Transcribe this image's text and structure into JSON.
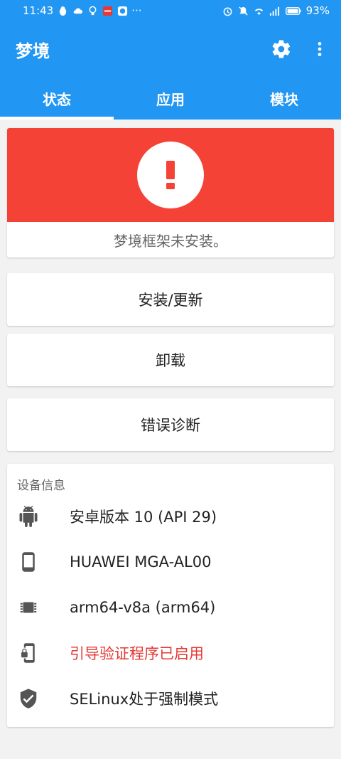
{
  "statusbar": {
    "time": "11:43",
    "more": "···",
    "battery": "93%"
  },
  "appbar": {
    "title": "梦境"
  },
  "tabs": [
    {
      "label": "状态"
    },
    {
      "label": "应用"
    },
    {
      "label": "模块"
    }
  ],
  "status": {
    "message": "梦境框架未安装。",
    "color": "#f44336"
  },
  "actions": [
    {
      "label": "安装/更新"
    },
    {
      "label": "卸载"
    },
    {
      "label": "错误诊断"
    }
  ],
  "device_info": {
    "title": "设备信息",
    "rows": [
      {
        "icon": "android-icon",
        "text": "安卓版本 10 (API 29)"
      },
      {
        "icon": "phone-icon",
        "text": "HUAWEI MGA-AL00"
      },
      {
        "icon": "chip-icon",
        "text": "arm64-v8a (arm64)"
      },
      {
        "icon": "phone-lock-icon",
        "text": "引导验证程序已启用",
        "color": "#e53935"
      },
      {
        "icon": "shield-check-icon",
        "text": "SELinux处于强制模式"
      }
    ]
  },
  "colors": {
    "primary": "#2196f3",
    "error": "#f44336"
  }
}
